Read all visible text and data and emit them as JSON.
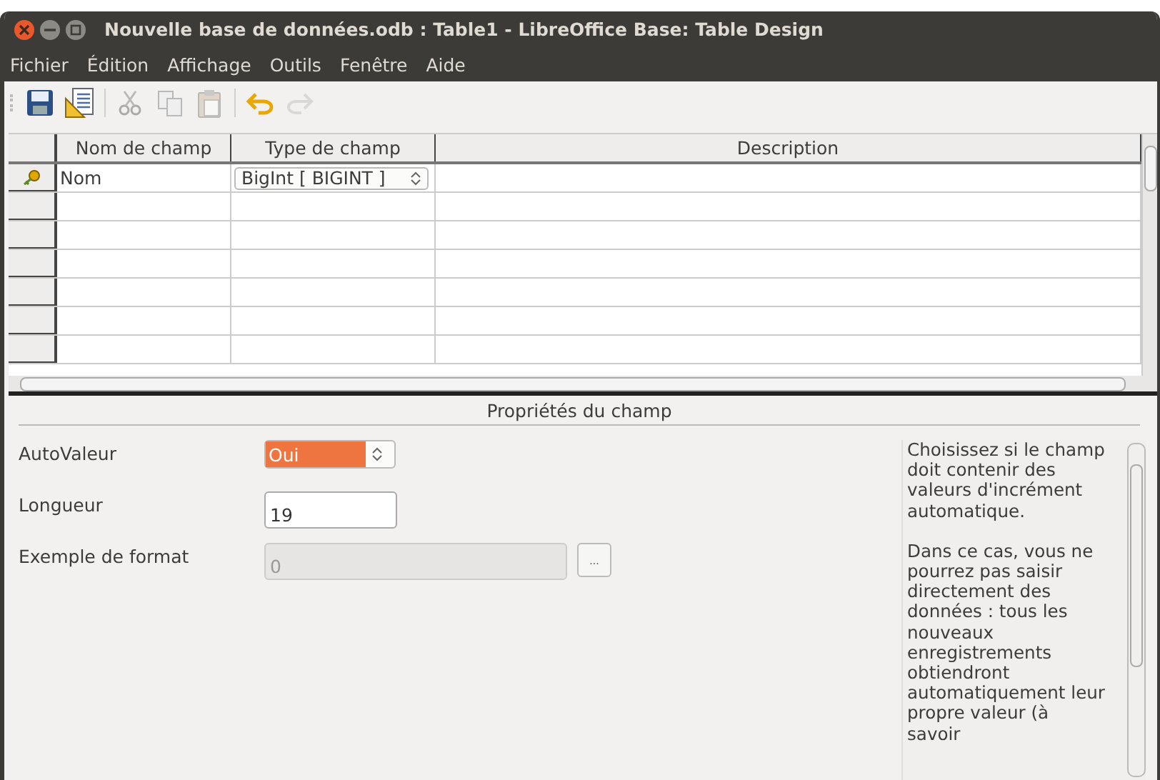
{
  "window": {
    "title": "Nouvelle base de données.odb : Table1 - LibreOffice Base: Table Design"
  },
  "menu": [
    "Fichier",
    "Édition",
    "Affichage",
    "Outils",
    "Fenêtre",
    "Aide"
  ],
  "toolbar": [
    {
      "kind": "save",
      "disabled": false
    },
    {
      "kind": "design",
      "disabled": false
    },
    {
      "kind": "separator"
    },
    {
      "kind": "cut",
      "disabled": true
    },
    {
      "kind": "copy",
      "disabled": true
    },
    {
      "kind": "paste",
      "disabled": true
    },
    {
      "kind": "separator"
    },
    {
      "kind": "undo",
      "disabled": false
    },
    {
      "kind": "redo",
      "disabled": true
    }
  ],
  "table": {
    "columns": [
      "Nom de champ",
      "Type de champ",
      "Description"
    ],
    "rows": [
      {
        "primary_key": true,
        "name": "Nom",
        "type": "BigInt [ BIGINT ]"
      }
    ]
  },
  "properties": {
    "title": "Propriétés du champ",
    "fields": [
      {
        "kind": "select",
        "label": "AutoValeur",
        "value": "Oui",
        "highlighted": true
      },
      {
        "kind": "input",
        "label": "Longueur",
        "value": "19",
        "disabled": false
      },
      {
        "kind": "input",
        "label": "Exemple de format",
        "value": "0",
        "disabled": true,
        "button": "..."
      }
    ],
    "help": [
      "Choisissez si le champ doit contenir des valeurs d'incrément automatique.",
      "Dans ce cas, vous ne pourrez pas saisir directement des données : tous les nouveaux enregistrements obtiendront automatiquement leur propre valeur (à savoir"
    ]
  }
}
